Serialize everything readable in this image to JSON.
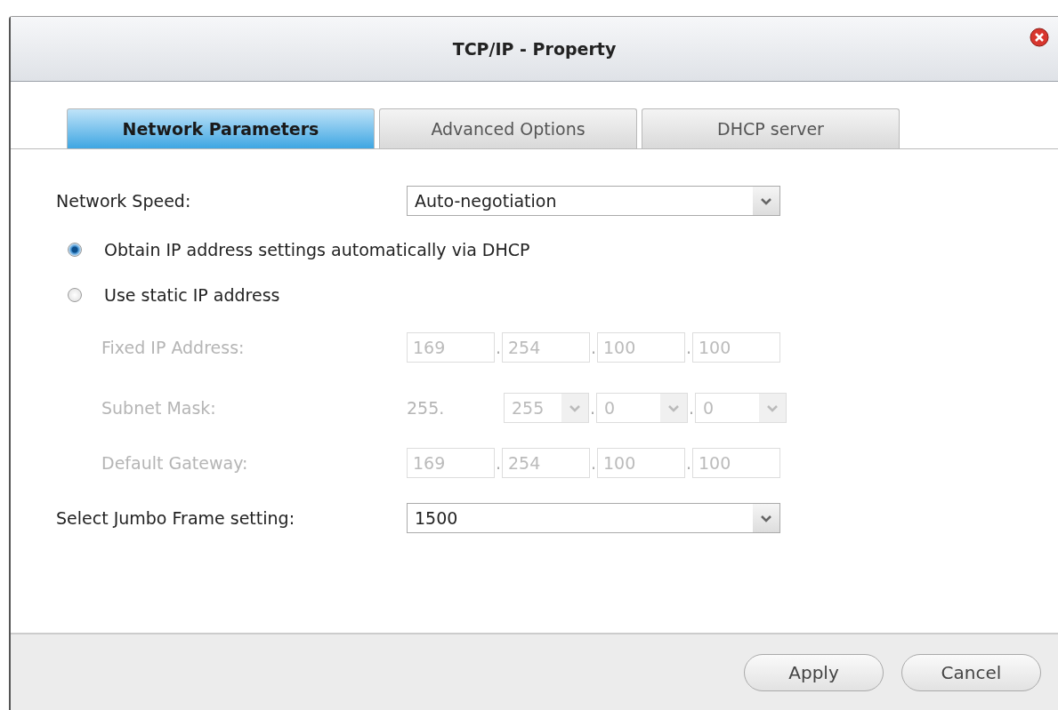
{
  "window": {
    "title": "TCP/IP - Property"
  },
  "tabs": [
    {
      "label": "Network Parameters",
      "selected": true
    },
    {
      "label": "Advanced Options",
      "selected": false
    },
    {
      "label": "DHCP server",
      "selected": false
    }
  ],
  "network_speed": {
    "label": "Network Speed:",
    "value": "Auto-negotiation"
  },
  "ip_mode": [
    {
      "label": "Obtain IP address settings automatically via DHCP",
      "selected": true
    },
    {
      "label": "Use static IP address",
      "selected": false
    }
  ],
  "static_fields": {
    "disabled": true,
    "separator": ".",
    "rows": [
      {
        "kind": "octets",
        "label": "Fixed IP Address:",
        "octets": [
          "169",
          "254",
          "100",
          "100"
        ]
      },
      {
        "kind": "mask",
        "label": "Subnet Mask:",
        "prefix": "255.",
        "octets": [
          "255",
          "0",
          "0"
        ]
      },
      {
        "kind": "octets",
        "label": "Default Gateway:",
        "octets": [
          "169",
          "254",
          "100",
          "100"
        ]
      }
    ]
  },
  "jumbo_frame": {
    "label": "Select Jumbo Frame setting:",
    "value": "1500"
  },
  "buttons": [
    {
      "label": "Apply"
    },
    {
      "label": "Cancel"
    }
  ]
}
